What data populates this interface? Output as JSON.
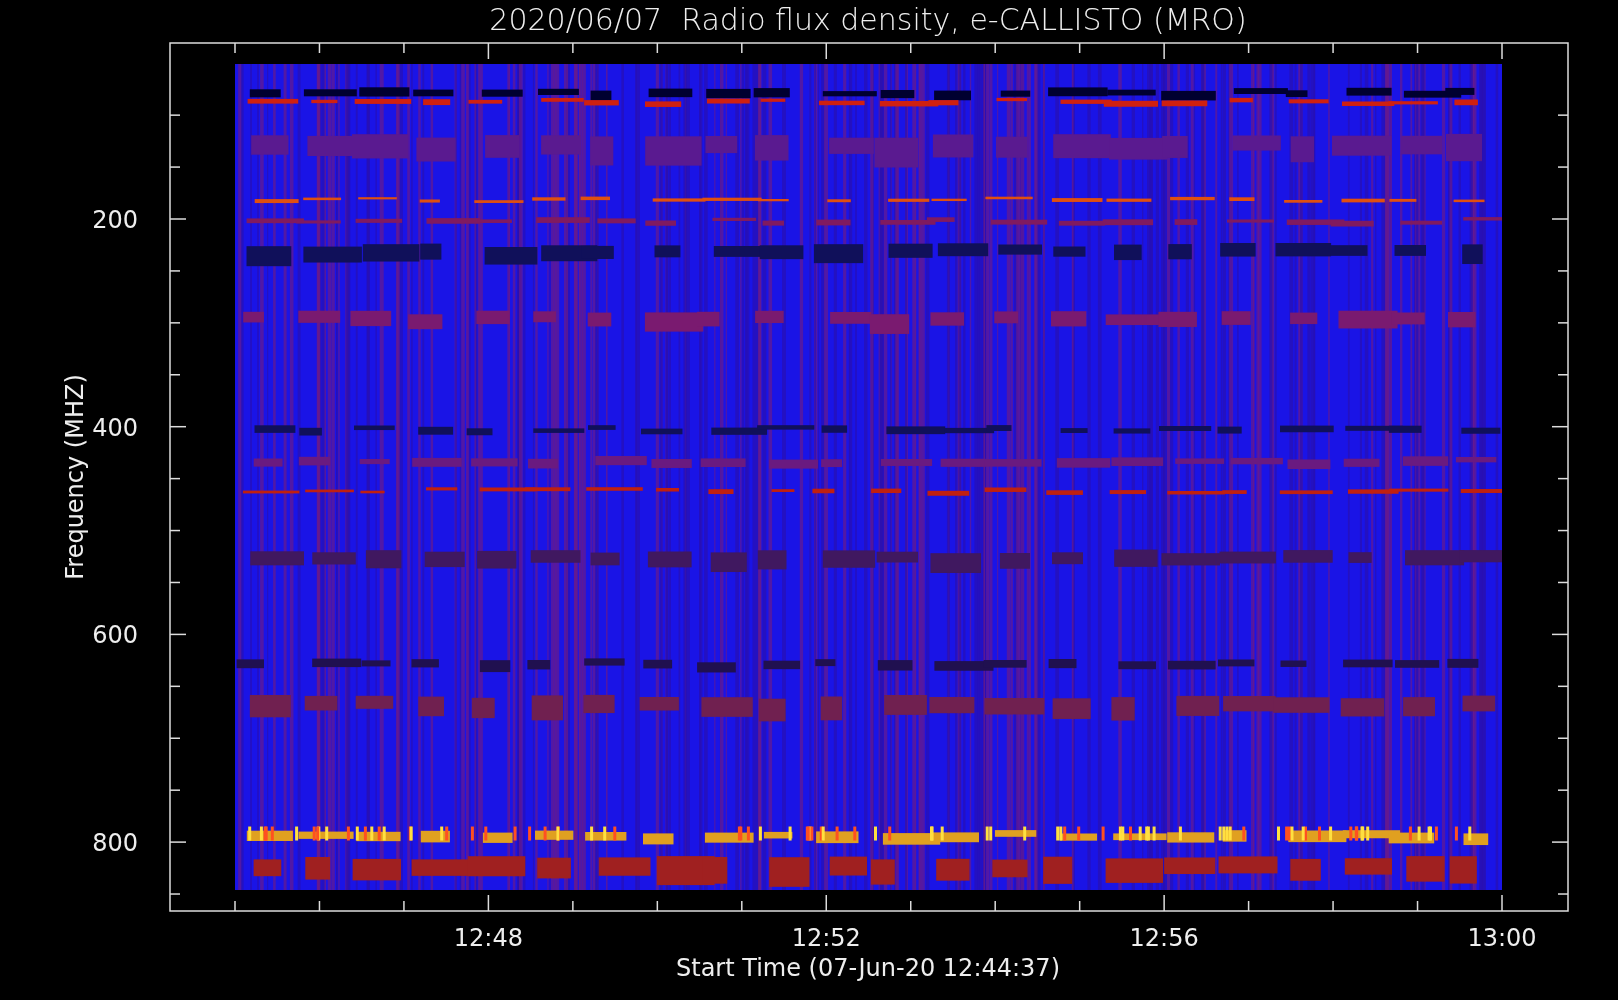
{
  "title": "2020/06/07  Radio flux density, e-CALLISTO (MRO)",
  "plot": {
    "ylabel": "Frequency (MHZ)",
    "xlabel": "Start Time (07-Jun-20 12:44:37)",
    "yticks": [
      {
        "label": "200"
      },
      {
        "label": "400"
      },
      {
        "label": "600"
      },
      {
        "label": "800"
      }
    ],
    "xticks": [
      {
        "label": "12:48"
      },
      {
        "label": "12:52"
      },
      {
        "label": "12:56"
      },
      {
        "label": "13:00"
      }
    ]
  }
}
